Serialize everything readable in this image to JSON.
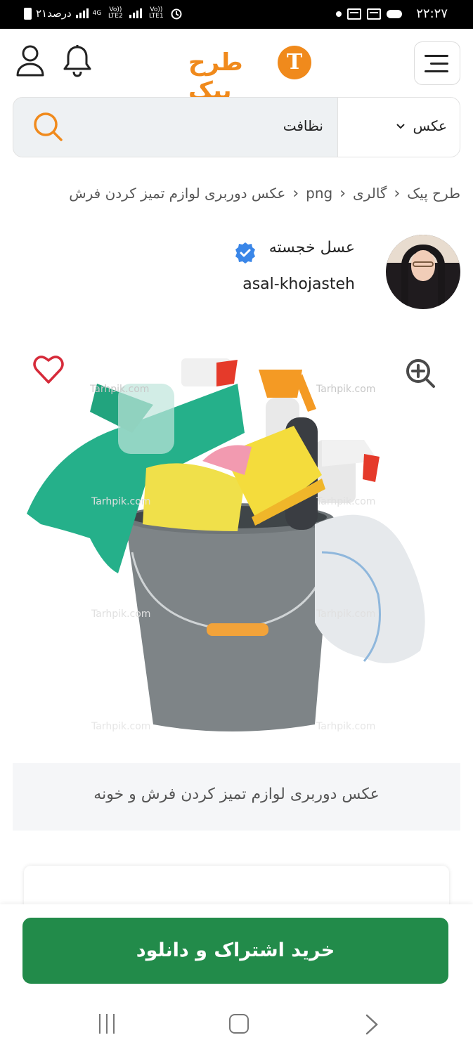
{
  "status_bar": {
    "time": "۲۲:۲۷",
    "battery_text": "۲۱درصد",
    "network1": "4G",
    "network_small1": "Vo)) LTE2",
    "network_small2": "Vo)) LTE1"
  },
  "header": {
    "logo_text": "طرح پیک",
    "logo_letter": "T",
    "brand_color": "#f08a1c",
    "icons": [
      "hamburger-menu-icon",
      "bell-icon",
      "user-icon"
    ]
  },
  "search": {
    "type_label": "عکس",
    "query": "نظافت"
  },
  "breadcrumb": {
    "items": [
      "طرح پیک",
      "گالری",
      "png",
      "عکس دوربری لوازم تمیز کردن فرش"
    ]
  },
  "author": {
    "name": "عسل خجسته",
    "handle": "asal-khojasteh",
    "verified_color": "#3a86e8"
  },
  "image": {
    "watermark": "Tarhpik.com",
    "caption": "عکس دوربری لوازم تمیز کردن فرش و خونه"
  },
  "cta": {
    "label": "خرید اشتراک و دانلود",
    "color": "#228b4a"
  }
}
